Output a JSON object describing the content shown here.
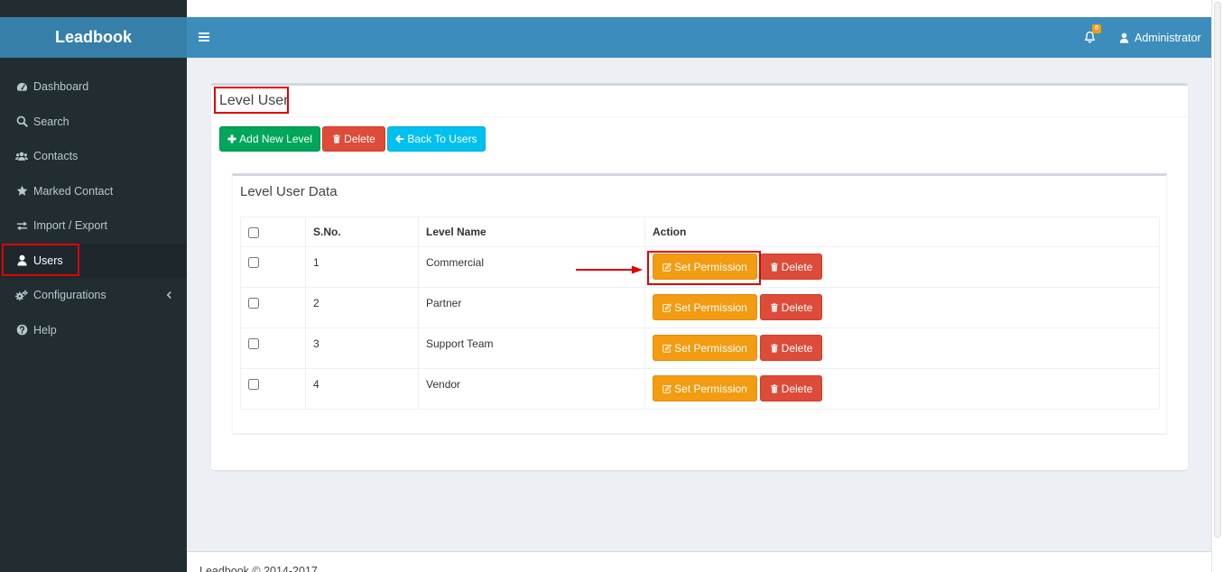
{
  "app": {
    "logo": "Leadbook"
  },
  "header": {
    "notification_count": "0",
    "user_name": "Administrator"
  },
  "sidebar": {
    "items": [
      {
        "label": "Dashboard",
        "icon": "dashboard-icon"
      },
      {
        "label": "Search",
        "icon": "search-icon"
      },
      {
        "label": "Contacts",
        "icon": "users-icon"
      },
      {
        "label": "Marked Contact",
        "icon": "star-icon"
      },
      {
        "label": "Import / Export",
        "icon": "exchange-icon"
      },
      {
        "label": "Users",
        "icon": "user-icon",
        "active": true
      },
      {
        "label": "Configurations",
        "icon": "cogs-icon",
        "has_submenu": true
      },
      {
        "label": "Help",
        "icon": "question-circle-icon"
      }
    ]
  },
  "page": {
    "title": "Level User",
    "toolbar": {
      "add_label": "Add New Level",
      "delete_label": "Delete",
      "back_label": "Back To Users"
    }
  },
  "level_table": {
    "title": "Level User Data",
    "header_checked": false,
    "columns": {
      "sno": "S.No.",
      "level_name": "Level Name",
      "action": "Action"
    },
    "rows": [
      {
        "sno": "1",
        "level_name": "Commercial",
        "checked": false
      },
      {
        "sno": "2",
        "level_name": "Partner",
        "checked": false
      },
      {
        "sno": "3",
        "level_name": "Support Team",
        "checked": false
      },
      {
        "sno": "4",
        "level_name": "Vendor",
        "checked": false
      }
    ],
    "actions": {
      "set_permission_label": "Set Permission",
      "delete_label": "Delete"
    }
  },
  "footer": {
    "copyright": "Leadbook © 2014-2017"
  },
  "colors": {
    "header": "#3c8dbc",
    "logo": "#367fa9",
    "sidebar": "#222d32",
    "sidebar_active": "#1e282c",
    "sidebar_text": "#b8c7ce",
    "content_bg": "#ecf0f5",
    "success": "#00a65a",
    "danger": "#dd4b39",
    "info": "#00c0ef",
    "warning": "#f39c12",
    "annotation": "#e00000"
  }
}
